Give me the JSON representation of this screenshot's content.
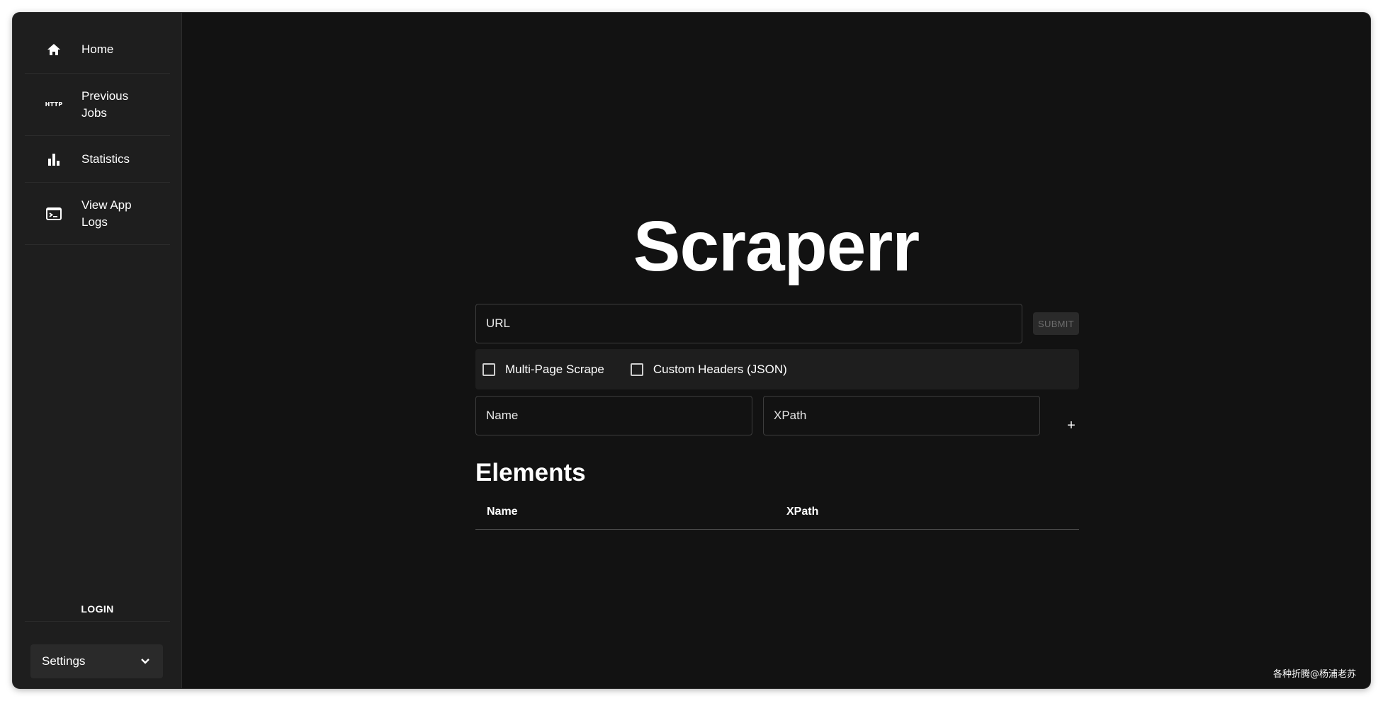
{
  "sidebar": {
    "items": [
      {
        "label": "Home",
        "icon": "home-icon"
      },
      {
        "label": "Previous Jobs",
        "icon": "http-icon",
        "icon_text": "HTTP"
      },
      {
        "label": "Statistics",
        "icon": "bar-chart-icon"
      },
      {
        "label": "View App Logs",
        "icon": "terminal-icon"
      }
    ],
    "login_label": "LOGIN",
    "settings_label": "Settings"
  },
  "main": {
    "title": "Scraperr",
    "url_placeholder": "URL",
    "submit_label": "SUBMIT",
    "options": [
      {
        "label": "Multi-Page Scrape",
        "checked": false
      },
      {
        "label": "Custom Headers (JSON)",
        "checked": false
      }
    ],
    "name_placeholder": "Name",
    "xpath_placeholder": "XPath",
    "add_label": "+",
    "elements_title": "Elements",
    "table_headers": [
      "Name",
      "XPath"
    ]
  },
  "watermark": "各种折腾@杨浦老苏",
  "colors": {
    "background": "#121212",
    "sidebar": "#1e1e1e",
    "text": "#ffffff",
    "border": "#3d3d3d"
  }
}
